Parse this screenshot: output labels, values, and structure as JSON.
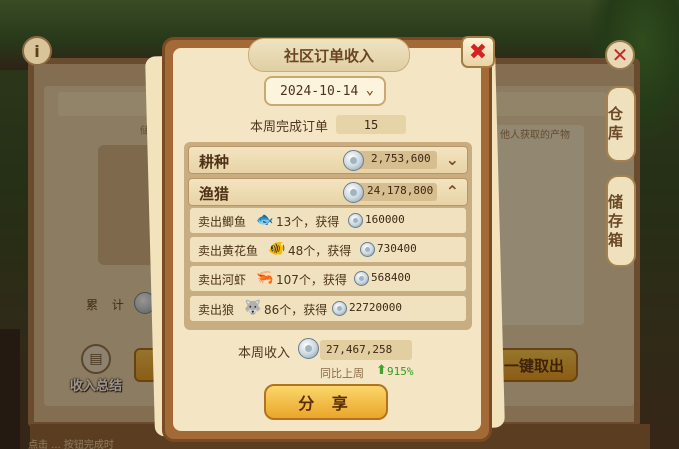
{
  "background": {
    "side_tabs": [
      "仓库",
      "储存箱"
    ],
    "cumulative_label": "累 计",
    "summary_button": "收入总结",
    "take_all_button": "一键取出",
    "back_hint_left": "储存",
    "back_hint_right": "他人获取的产物",
    "bottom_text": "点击 ... 按钮完成时"
  },
  "modal": {
    "title": "社区订单收入",
    "date": "2024-10-14",
    "weekly_orders_label": "本周完成订单",
    "weekly_orders_value": "15",
    "categories": [
      {
        "name": "耕种",
        "amount": "2,753,600",
        "expanded": false
      },
      {
        "name": "渔猎",
        "amount": "24,178,800",
        "expanded": true
      }
    ],
    "details": [
      {
        "prefix": "卖出鲫鱼",
        "icon": "crucian-fish-icon",
        "count": "13个，获得",
        "value": "160000"
      },
      {
        "prefix": "卖出黄花鱼",
        "icon": "yellow-croaker-icon",
        "count": "48个，获得",
        "value": "730400"
      },
      {
        "prefix": "卖出河虾",
        "icon": "river-shrimp-icon",
        "count": "107个，获得",
        "value": "568400"
      },
      {
        "prefix": "卖出狼",
        "icon": "wolf-icon",
        "count": "86个，获得",
        "value": "22720000"
      }
    ],
    "weekly_income_label": "本周收入",
    "weekly_income_value": "27,467,258",
    "compare_label": "同比上周",
    "compare_value": "915%",
    "share_button": "分 享"
  },
  "colors": {
    "frame": "#a36a37",
    "panel": "#f4e6c4",
    "accent_button": "#f1b83f",
    "close_x": "#d42222",
    "positive": "#2f9c22"
  }
}
